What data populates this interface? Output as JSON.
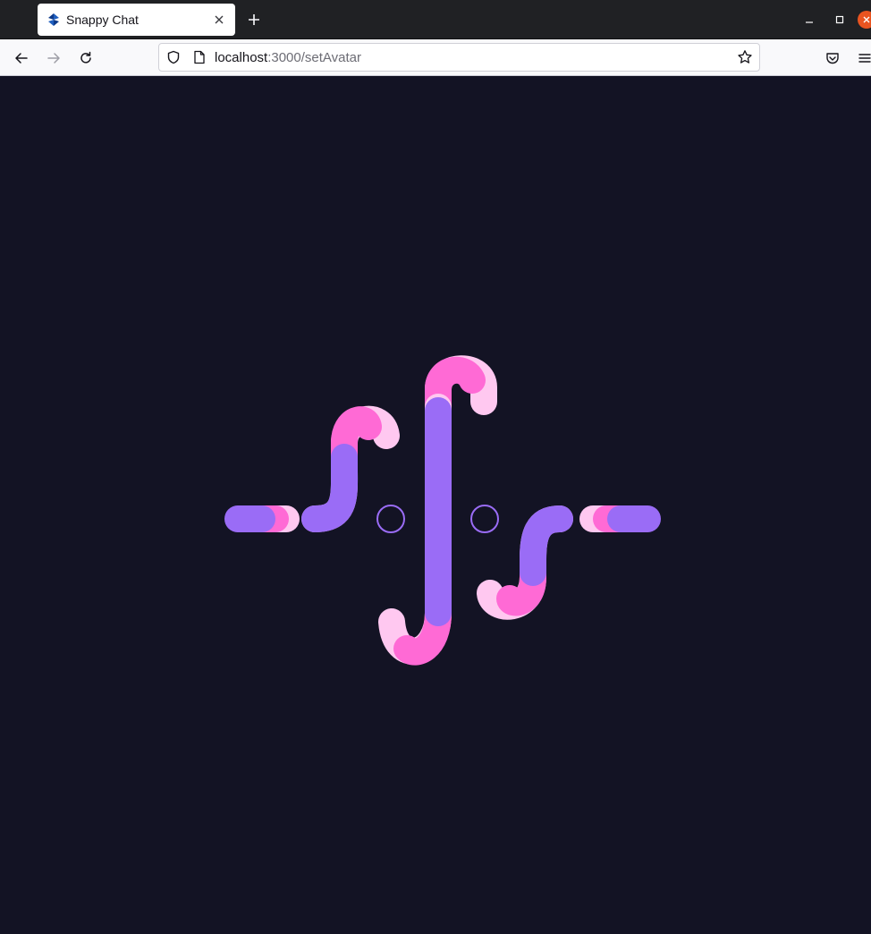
{
  "browser": {
    "tab": {
      "title": "Snappy Chat",
      "favicon": "app-logo-icon",
      "close_icon": "close-icon"
    },
    "new_tab_icon": "plus-icon",
    "window_controls": [
      "minimize-icon",
      "maximize-icon",
      "close-icon"
    ],
    "nav": {
      "back_icon": "arrow-left-icon",
      "forward_icon": "arrow-right-icon",
      "reload_icon": "reload-icon",
      "pocket_icon": "pocket-icon",
      "menu_icon": "hamburger-menu-icon"
    },
    "url": {
      "host": "localhost",
      "path": ":3000/setAvatar",
      "security_icon": "shield-icon",
      "page_icon": "page-icon",
      "bookmark_icon": "star-icon"
    }
  },
  "page": {
    "background": "#131324",
    "loader": {
      "icon": "loading-animation",
      "colors": {
        "purple": "#9a6cf6",
        "pink": "#ff6ad5",
        "light_pink": "#ffc8f0"
      }
    }
  }
}
